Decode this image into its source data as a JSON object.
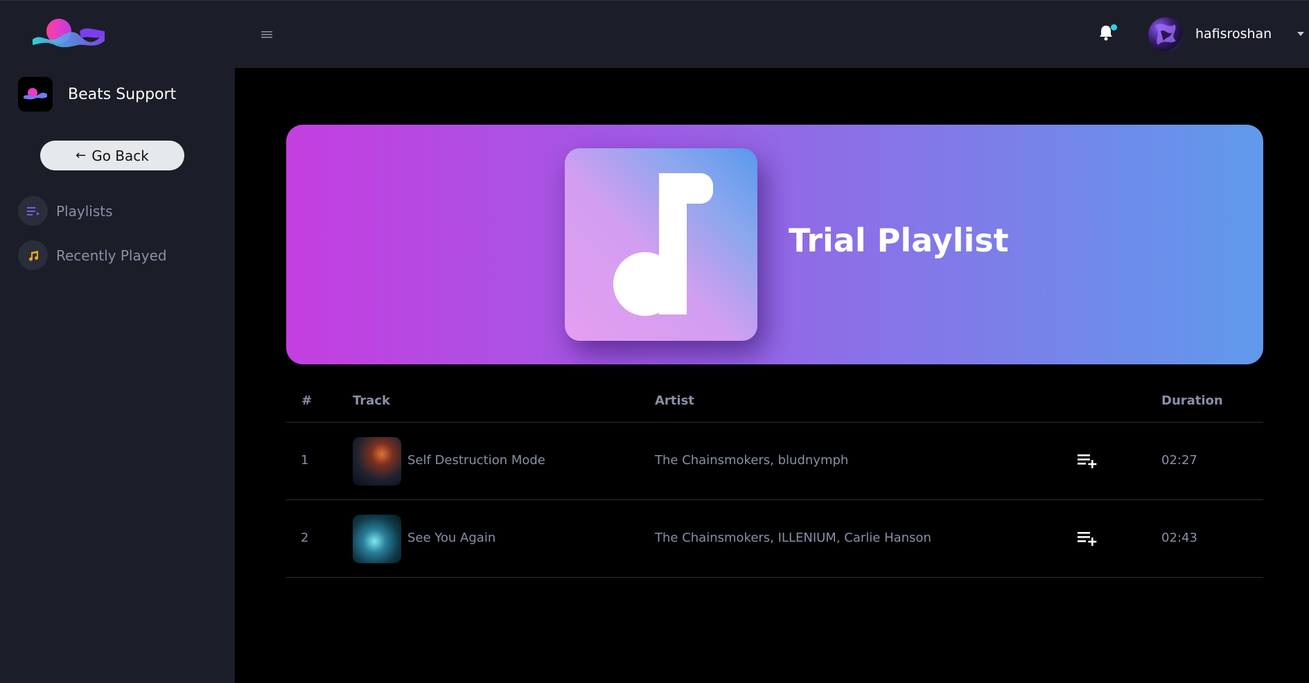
{
  "sidebar": {
    "brand_name": "Beats Support",
    "go_back_label": "Go Back",
    "items": [
      {
        "label": "Playlists",
        "icon": "playlist-icon",
        "icon_color": "#7b5cf0"
      },
      {
        "label": "Recently Played",
        "icon": "music-note-icon",
        "icon_color": "#f0a91a"
      }
    ]
  },
  "topbar": {
    "username": "hafisroshan",
    "notification_dot_color": "#2bd3e8"
  },
  "playlist": {
    "title": "Trial Playlist",
    "columns": {
      "index": "#",
      "track": "Track",
      "artist": "Artist",
      "duration": "Duration"
    },
    "tracks": [
      {
        "index": "1",
        "title": "Self Destruction Mode",
        "artist": "The Chainsmokers, bludnymph",
        "duration": "02:27"
      },
      {
        "index": "2",
        "title": "See You Again",
        "artist": "The Chainsmokers, ILLENIUM, Carlie Hanson",
        "duration": "02:43"
      }
    ]
  },
  "colors": {
    "sidebar_bg": "#1b1e29",
    "content_bg": "#000000",
    "banner_gradient_start": "#c43ee0",
    "banner_gradient_end": "#5f9aec",
    "muted_text": "#8a8fa5"
  }
}
